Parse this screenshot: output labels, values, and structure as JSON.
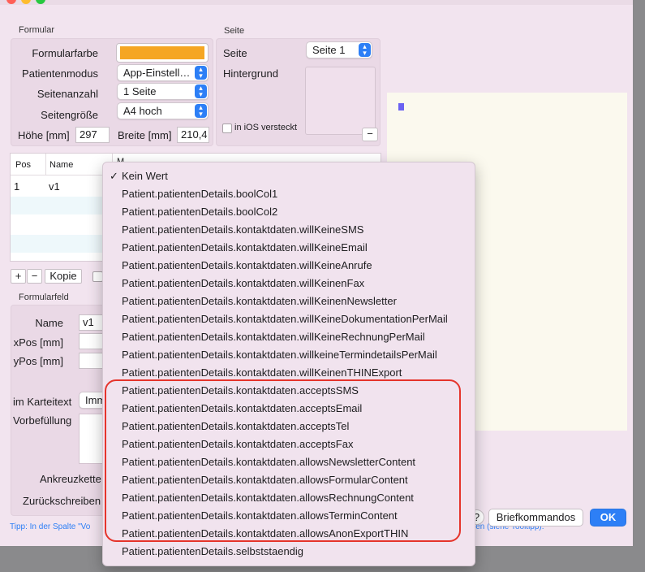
{
  "formular": {
    "section_title": "Formular",
    "formularfarbe_label": "Formularfarbe",
    "formularfarbe_color": "#f5a623",
    "patientenmodus_label": "Patientenmodus",
    "patientenmodus_value": "App-Einstell…",
    "seitenanzahl_label": "Seitenanzahl",
    "seitenanzahl_value": "1 Seite",
    "seitengroesse_label": "Seitengröße",
    "seitengroesse_value": "A4 hoch",
    "hoehe_label": "Höhe [mm]",
    "hoehe_value": "297",
    "breite_label": "Breite [mm]",
    "breite_value": "210,4"
  },
  "seite": {
    "section_title": "Seite",
    "seite_label": "Seite",
    "seite_value": "Seite 1",
    "hintergrund_label": "Hintergrund",
    "ios_label": "in iOS versteckt",
    "minus": "−"
  },
  "table": {
    "col_pos": "Pos",
    "col_name": "Name",
    "col_m": "M",
    "rows": [
      {
        "pos": "1",
        "name": "v1"
      }
    ]
  },
  "table_buttons": {
    "add": "+",
    "remove": "−",
    "copy": "Kopie"
  },
  "formularfeld": {
    "section_title": "Formularfeld",
    "name_label": "Name",
    "name_value": "v1",
    "xpos_label": "xPos [mm]",
    "ypos_label": "yPos [mm]",
    "karteitext_label": "im Karteitext",
    "karteitext_value": "Imm",
    "vorbefuellung_label": "Vorbefüllung",
    "ankreuzkette_label": "Ankreuzkette",
    "zurueckschreiben_label": "Zurückschreiben"
  },
  "tip": {
    "left": "Tipp: In der Spalte \"Vo",
    "right": "jen (siehe Tooltipp)."
  },
  "bottom_buttons": {
    "help": "?",
    "briefkommandos": "Briefkommandos",
    "ok": "OK"
  },
  "colors": {
    "accent": "#2d7ff6",
    "highlight": "#e5342b",
    "window_bg": "#f2e4ef"
  },
  "menu": {
    "checkmark": "✓",
    "items": [
      "Kein Wert",
      "Patient.patientenDetails.boolCol1",
      "Patient.patientenDetails.boolCol2",
      "Patient.patientenDetails.kontaktdaten.willKeineSMS",
      "Patient.patientenDetails.kontaktdaten.willKeineEmail",
      "Patient.patientenDetails.kontaktdaten.willKeineAnrufe",
      "Patient.patientenDetails.kontaktdaten.willKeinenFax",
      "Patient.patientenDetails.kontaktdaten.willKeinenNewsletter",
      "Patient.patientenDetails.kontaktdaten.willKeineDokumentationPerMail",
      "Patient.patientenDetails.kontaktdaten.willKeineRechnungPerMail",
      "Patient.patientenDetails.kontaktdaten.willkeineTermindetailsPerMail",
      "Patient.patientenDetails.kontaktdaten.willKeinenTHINExport",
      "Patient.patientenDetails.kontaktdaten.acceptsSMS",
      "Patient.patientenDetails.kontaktdaten.acceptsEmail",
      "Patient.patientenDetails.kontaktdaten.acceptsTel",
      "Patient.patientenDetails.kontaktdaten.acceptsFax",
      "Patient.patientenDetails.kontaktdaten.allowsNewsletterContent",
      "Patient.patientenDetails.kontaktdaten.allowsFormularContent",
      "Patient.patientenDetails.kontaktdaten.allowsRechnungContent",
      "Patient.patientenDetails.kontaktdaten.allowsTerminContent",
      "Patient.patientenDetails.kontaktdaten.allowsAnonExportTHIN",
      "Patient.patientenDetails.selbststaendig"
    ]
  }
}
